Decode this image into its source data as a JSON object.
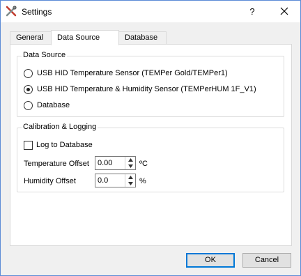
{
  "window": {
    "title": "Settings",
    "help_label": "?"
  },
  "tabs": [
    {
      "label": "General",
      "selected": false
    },
    {
      "label": "Data Source",
      "selected": true
    },
    {
      "label": "Database",
      "selected": false
    }
  ],
  "data_source": {
    "legend": "Data Source",
    "options": [
      {
        "label": "USB HID Temperature Sensor (TEMPer Gold/TEMPer1)",
        "selected": false
      },
      {
        "label": "USB HID Temperature & Humidity Sensor (TEMPerHUM 1F_V1)",
        "selected": true
      },
      {
        "label": "Database",
        "selected": false
      }
    ]
  },
  "calibration": {
    "legend": "Calibration & Logging",
    "log_to_database": {
      "label": "Log to Database",
      "checked": false
    },
    "temperature_offset": {
      "label": "Temperature Offset",
      "value": "0.00",
      "unit": "ºC"
    },
    "humidity_offset": {
      "label": "Humidity Offset",
      "value": "0.0",
      "unit": "%"
    }
  },
  "buttons": {
    "ok": "OK",
    "cancel": "Cancel"
  },
  "icons": {
    "title": "tools-icon",
    "close": "close-icon",
    "spin_up": "chevron-up-icon",
    "spin_down": "chevron-down-icon"
  },
  "colors": {
    "accent": "#0078d7",
    "panel": "#ffffff",
    "window_bg": "#f0f0f0"
  }
}
